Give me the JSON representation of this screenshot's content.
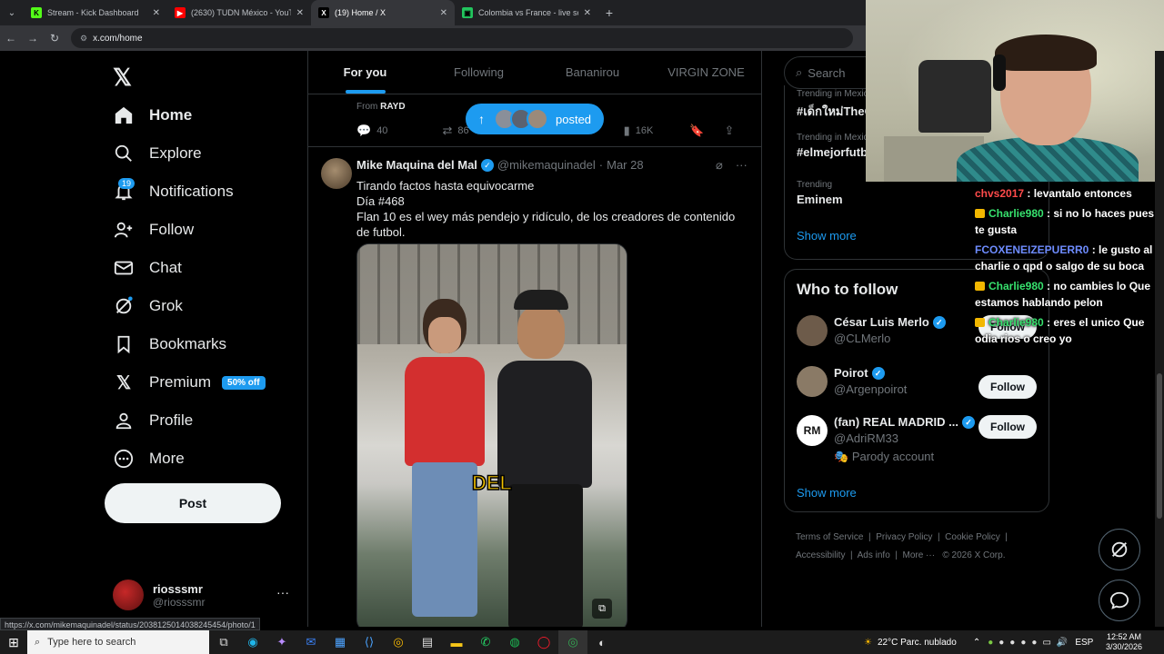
{
  "browser": {
    "tabs": [
      {
        "title": "Stream - Kick Dashboard",
        "color": "#53fc18",
        "glyph": "K"
      },
      {
        "title": "(2630) TUDN México - YouTube",
        "color": "#ff0000",
        "glyph": "▶"
      },
      {
        "title": "(19) Home / X",
        "color": "#ffffff",
        "glyph": "X"
      },
      {
        "title": "Colombia vs France - live score",
        "color": "#22c55e",
        "glyph": "▣"
      }
    ],
    "url": "x.com/home",
    "status_url": "https://x.com/mikemaquinadel/status/2038125014038245454/photo/1"
  },
  "sidebar": {
    "items": [
      {
        "label": "Home",
        "icon": "home-icon",
        "glyph": "⌂"
      },
      {
        "label": "Explore",
        "icon": "search-icon",
        "glyph": "⌕"
      },
      {
        "label": "Notifications",
        "icon": "bell-icon",
        "glyph": "🔔"
      },
      {
        "label": "Follow",
        "icon": "follow-icon",
        "glyph": "👤"
      },
      {
        "label": "Chat",
        "icon": "mail-icon",
        "glyph": "✉"
      },
      {
        "label": "Grok",
        "icon": "grok-icon",
        "glyph": "⌀"
      },
      {
        "label": "Bookmarks",
        "icon": "bookmark-icon",
        "glyph": "🔖"
      },
      {
        "label": "Premium",
        "icon": "x-logo-icon",
        "glyph": "𝕏"
      },
      {
        "label": "Profile",
        "icon": "profile-icon",
        "glyph": "👤"
      },
      {
        "label": "More",
        "icon": "more-icon",
        "glyph": "⋯"
      }
    ],
    "notif_count": "19",
    "premium_badge": "50% off",
    "post_label": "Post",
    "account": {
      "name": "riosssmr",
      "handle": "@riosssmr"
    }
  },
  "timeline": {
    "tabs": [
      "For you",
      "Following",
      "Bananirou",
      "VIRGIN ZONE"
    ],
    "prev_tweet": {
      "from_prefix": "From",
      "from_name": "RAYD",
      "replies": "40",
      "retweets": "86",
      "views": "16K"
    },
    "posted_pill": "posted",
    "tweet": {
      "name": "Mike Maquina del Mal",
      "handle": "@mikemaquinadel",
      "date": "Mar 28",
      "text_line1": "Tirando factos hasta equivocarme",
      "text_line2": "Día #468",
      "text_line3": "Flan 10 es el wey más pendejo y ridículo, de los creadores de contenido de futbol.",
      "media_caption": "DEL"
    }
  },
  "right": {
    "search_placeholder": "Search",
    "trends": [
      {
        "meta": "Trending in Mexico",
        "title": "#เด็กใหม่TheGentleGirl"
      },
      {
        "meta": "Trending in Mexico",
        "title": "#elmejorfutbol"
      },
      {
        "meta": "Trending",
        "title": "Eminem"
      }
    ],
    "show_more": "Show more",
    "who_to_follow_title": "Who to follow",
    "suggestions": [
      {
        "name": "César Luis Merlo",
        "handle": "@CLMerlo",
        "parody": ""
      },
      {
        "name": "Poirot",
        "handle": "@Argenpoirot",
        "parody": ""
      },
      {
        "name": "(fan) REAL MADRID ...",
        "handle": "@AdriRM33",
        "parody": "Parody account"
      }
    ],
    "follow_label": "Follow",
    "footer": [
      "Terms of Service",
      "Privacy Policy",
      "Cookie Policy",
      "Accessibility",
      "Ads info",
      "More ···",
      "© 2026 X Corp."
    ]
  },
  "chat": [
    {
      "user": "chvs2017",
      "color": "u1",
      "crown": false,
      "msg": " : levantalo entonces"
    },
    {
      "user": "Charlie980",
      "color": "u2",
      "crown": true,
      "msg": " : si no lo haces pues te gusta"
    },
    {
      "user": "FCOXENEIZEPUERR0",
      "color": "u3",
      "crown": false,
      "msg": " : le gusto al charlie o qpd o salgo de su boca"
    },
    {
      "user": "Charlie980",
      "color": "u2",
      "crown": true,
      "msg": " : no cambies lo Que estamos hablando pelon"
    },
    {
      "user": "Charlie980",
      "color": "u2",
      "crown": true,
      "msg": " : eres el unico Que odia rios o creo yo"
    }
  ],
  "taskbar": {
    "search_placeholder": "Type here to search",
    "weather": "22°C  Parc. nublado",
    "lang": "ESP",
    "time": "12:52 AM",
    "date": "3/30/2026"
  }
}
